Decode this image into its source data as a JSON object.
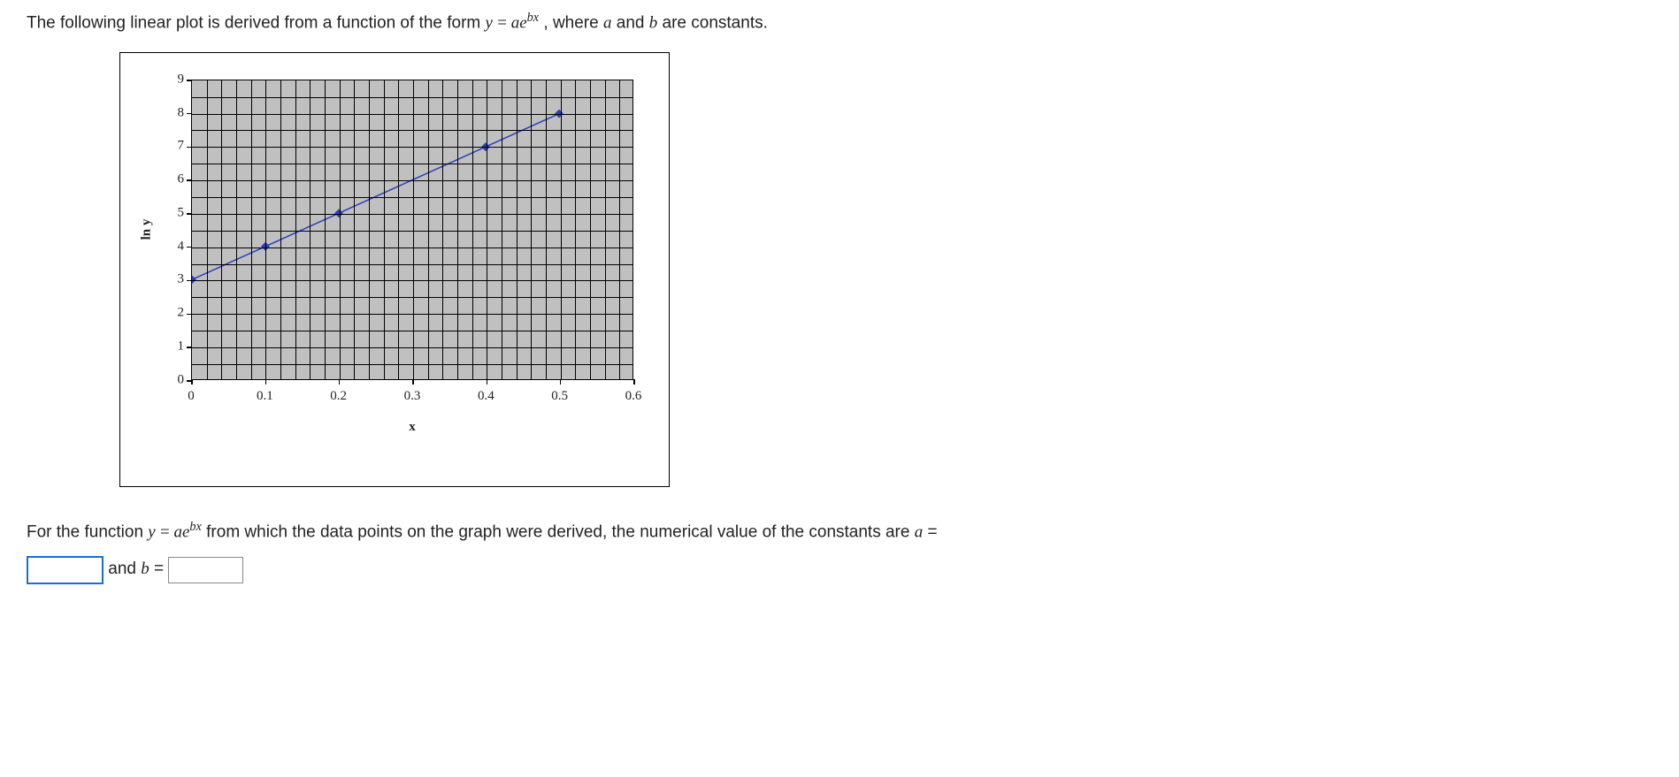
{
  "question": {
    "intro_pre": "The following linear plot is derived from a function of the form ",
    "intro_post": ", where ",
    "intro_tail": " are constants.",
    "const_a": "a",
    "const_and": " and ",
    "const_b": "b",
    "eq_y": "y",
    "eq_equals": " = ",
    "eq_a": "a",
    "eq_e": "e",
    "eq_exp_b": "b",
    "eq_exp_x": "x"
  },
  "answer": {
    "pre": "For the function ",
    "mid": " from which the data points on the graph were derived, the numerical value of the constants are ",
    "a_eq": " =",
    "and_label": " and ",
    "b_eq": " = ",
    "input_a": "",
    "input_b": ""
  },
  "chart_data": {
    "type": "scatter",
    "xlabel": "x",
    "ylabel": "ln y",
    "xlim": [
      0,
      0.6
    ],
    "ylim": [
      0,
      9
    ],
    "x_ticks": [
      0,
      0.1,
      0.2,
      0.3,
      0.4,
      0.5,
      0.6
    ],
    "y_ticks": [
      0,
      1,
      2,
      3,
      4,
      5,
      6,
      7,
      8,
      9
    ],
    "x_tick_labels": [
      "0",
      "0.1",
      "0.2",
      "0.3",
      "0.4",
      "0.5",
      "0.6"
    ],
    "y_tick_labels": [
      "0",
      "1",
      "2",
      "3",
      "4",
      "5",
      "6",
      "7",
      "8",
      "9"
    ],
    "minor_x_count": 30,
    "minor_y_count": 18,
    "series": [
      {
        "name": "data",
        "marker": "diamond",
        "color": "#2b3fb8",
        "line": true,
        "x": [
          0,
          0.1,
          0.2,
          0.4,
          0.5
        ],
        "y": [
          3,
          4,
          5,
          7,
          8
        ]
      }
    ]
  }
}
